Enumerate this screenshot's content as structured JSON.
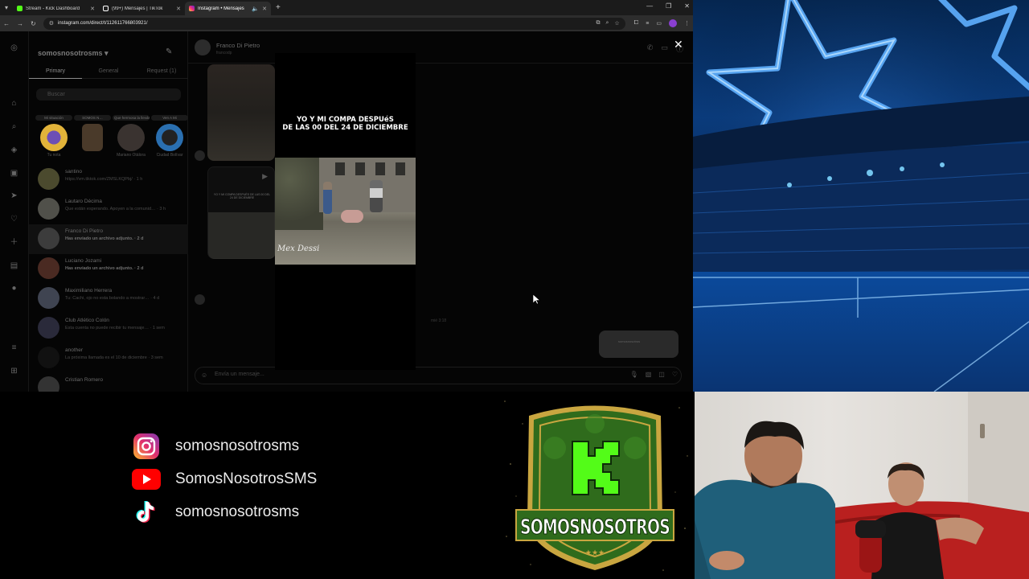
{
  "browser": {
    "tabs": [
      {
        "label": "Stream - Kick Dashboard",
        "color": "#53fc18"
      },
      {
        "label": "(99+) Mensajes | TikTok",
        "color": "#ffffff"
      },
      {
        "label": "Instagram • Mensajes",
        "color": "#e1306c"
      }
    ],
    "url": "instagram.com/direct/t/112611766803921/"
  },
  "instagram": {
    "username": "somosnosotrosms",
    "inbox_tabs": [
      "Primary",
      "General",
      "Request (1)"
    ],
    "search_placeholder": "Buscar",
    "notes": [
      {
        "bubble": "Mi situación",
        "name": "Tu nota"
      },
      {
        "bubble": "SOMOS N…",
        "name": ""
      },
      {
        "bubble": "Que hermosa la llevás",
        "name": "Mariano Otálora"
      },
      {
        "bubble": "Ven A Mi",
        "name": "Ciudad Bolívar"
      }
    ],
    "threads": [
      {
        "name": "santino",
        "preview": "https://vm.tiktok.com/ZMSLKQPbj/ · 1 h",
        "bold": false
      },
      {
        "name": "Lautaro Décima",
        "preview": "Que están esperando. Apoyen a la comunid… · 3 h",
        "bold": false
      },
      {
        "name": "Franco Di Pietro",
        "preview": "Has enviado un archivo adjunto. · 2 d",
        "bold": true
      },
      {
        "name": "Luciano Jozami",
        "preview": "Has enviado un archivo adjunto. · 2 d",
        "bold": true
      },
      {
        "name": "Maximiliano Herrera",
        "preview": "Tu: Cachi, ojo no esta bolando a mostrar… · 4 d",
        "bold": false
      },
      {
        "name": "Club Atlético Colón",
        "preview": "Esta cuenta no puede recibir tu mensaje… · 1 sem",
        "bold": false
      },
      {
        "name": "another",
        "preview": "La próxima llamada es el 10 de diciembre · 3 sem",
        "bold": false
      },
      {
        "name": "Cristian Romero",
        "preview": "",
        "bold": false
      }
    ],
    "chat": {
      "name": "Franco Di Pietro",
      "handle": "francodp",
      "timestamp": "mié 3:18",
      "sent_preview": "somosnosotros",
      "composer_placeholder": "Envía un mensaje...",
      "reel_caption": "YO Y MI COMPA DESPUÉS DE LAS 00 DEL 24 DE DICIEMBRE"
    },
    "video": {
      "caption_line1": "YO Y MI COMPA DESPUéS",
      "caption_line2": "DE LAS 00 DEL 24 DE DICIEMBRE",
      "watermark": "Mex Dessi"
    }
  },
  "socials": [
    {
      "platform": "instagram",
      "icon": "instagram-icon",
      "handle": "somosnosotrosms"
    },
    {
      "platform": "youtube",
      "icon": "youtube-icon",
      "handle": "SomosNosotrosSMS"
    },
    {
      "platform": "tiktok",
      "icon": "tiktok-icon",
      "handle": "somosnosotrosms"
    }
  ],
  "logo": {
    "letter": "K",
    "name": "SOMOSNOSOTROS",
    "stars": "★★★",
    "colors": {
      "green": "#2f6b1c",
      "kick": "#53fc18",
      "gold": "#c9a640"
    }
  }
}
